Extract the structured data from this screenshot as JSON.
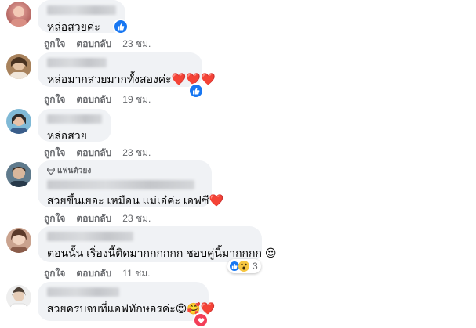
{
  "comments": [
    {
      "text": "หล่อสวยค่ะ",
      "like": "ถูกใจ",
      "reply": "ตอบกลับ",
      "time": "23 ชม.",
      "hearts": 0,
      "emojis": ""
    },
    {
      "text": "หล่อมากสวยมากทั้งสองค่ะ",
      "like": "ถูกใจ",
      "reply": "ตอบกลับ",
      "time": "19 ชม.",
      "hearts": 3,
      "emojis": ""
    },
    {
      "text": "หล่อสวย",
      "like": "ถูกใจ",
      "reply": "ตอบกลับ",
      "time": "23 ชม.",
      "hearts": 0,
      "emojis": ""
    },
    {
      "badge": "แฟนตัวยง",
      "text": "สวยขึ้นเยอะ เหมือน แม่เอ๋ค่ะ เอฟซี",
      "like": "ถูกใจ",
      "reply": "ตอบกลับ",
      "time": "23 ชม.",
      "hearts": 1,
      "emojis": ""
    },
    {
      "text": "ตอนนั้น เริ่องนี้ติดมากกกกกก ชอบคู่นี้มากกกก",
      "like": "ถูกใจ",
      "reply": "ตอบกลับ",
      "time": "11 ชม.",
      "hearts": 0,
      "emojis": "😍",
      "reaction_count": "3"
    },
    {
      "text": "สวยครบจบที่แอฟทักษอรค่ะ",
      "hearts": 1,
      "emojis": "😍🥰"
    }
  ],
  "colors": {
    "like_blue": "#1877f2",
    "heart_red": "#e0223d",
    "meta_gray": "#65676b",
    "bubble_bg": "#f0f2f5"
  }
}
